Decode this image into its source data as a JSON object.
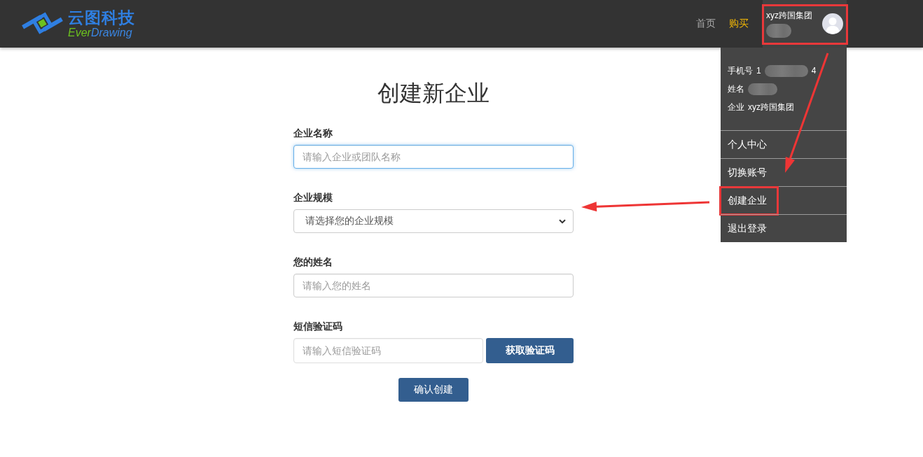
{
  "header": {
    "logo": {
      "title": "云图科技",
      "subtitle_parts": [
        "Ever",
        "Drawing"
      ]
    },
    "nav": [
      {
        "label": "首页",
        "selected": false
      },
      {
        "label": "购买",
        "selected": true
      }
    ],
    "user": {
      "company": "xyz跨国集团",
      "name_redacted": true,
      "highlighted": true
    }
  },
  "dropdown": {
    "info": [
      {
        "label": "手机号",
        "value": "1",
        "redacted": true,
        "value_after": "4"
      },
      {
        "label": "姓名",
        "redacted": true
      },
      {
        "label": "企业",
        "value": "xyz跨国集团",
        "redacted": false
      }
    ],
    "items": [
      {
        "label": "个人中心",
        "highlighted": false
      },
      {
        "label": "切换账号",
        "highlighted": false
      },
      {
        "label": "创建企业",
        "highlighted": true
      },
      {
        "label": "退出登录",
        "highlighted": false
      }
    ]
  },
  "form": {
    "title": "创建新企业",
    "fields": [
      {
        "kind": "input",
        "label": "企业名称",
        "placeholder": "请输入企业或团队名称",
        "focused": true
      },
      {
        "kind": "select",
        "label": "企业规模",
        "value": "请选择您的企业规模"
      },
      {
        "kind": "input",
        "label": "您的姓名",
        "placeholder": "请输入您的姓名",
        "focused": false
      },
      {
        "kind": "input_with_button",
        "label": "短信验证码",
        "placeholder": "请输入短信验证码",
        "focused": false,
        "button": "获取验证码"
      }
    ],
    "submit": "确认创建"
  }
}
